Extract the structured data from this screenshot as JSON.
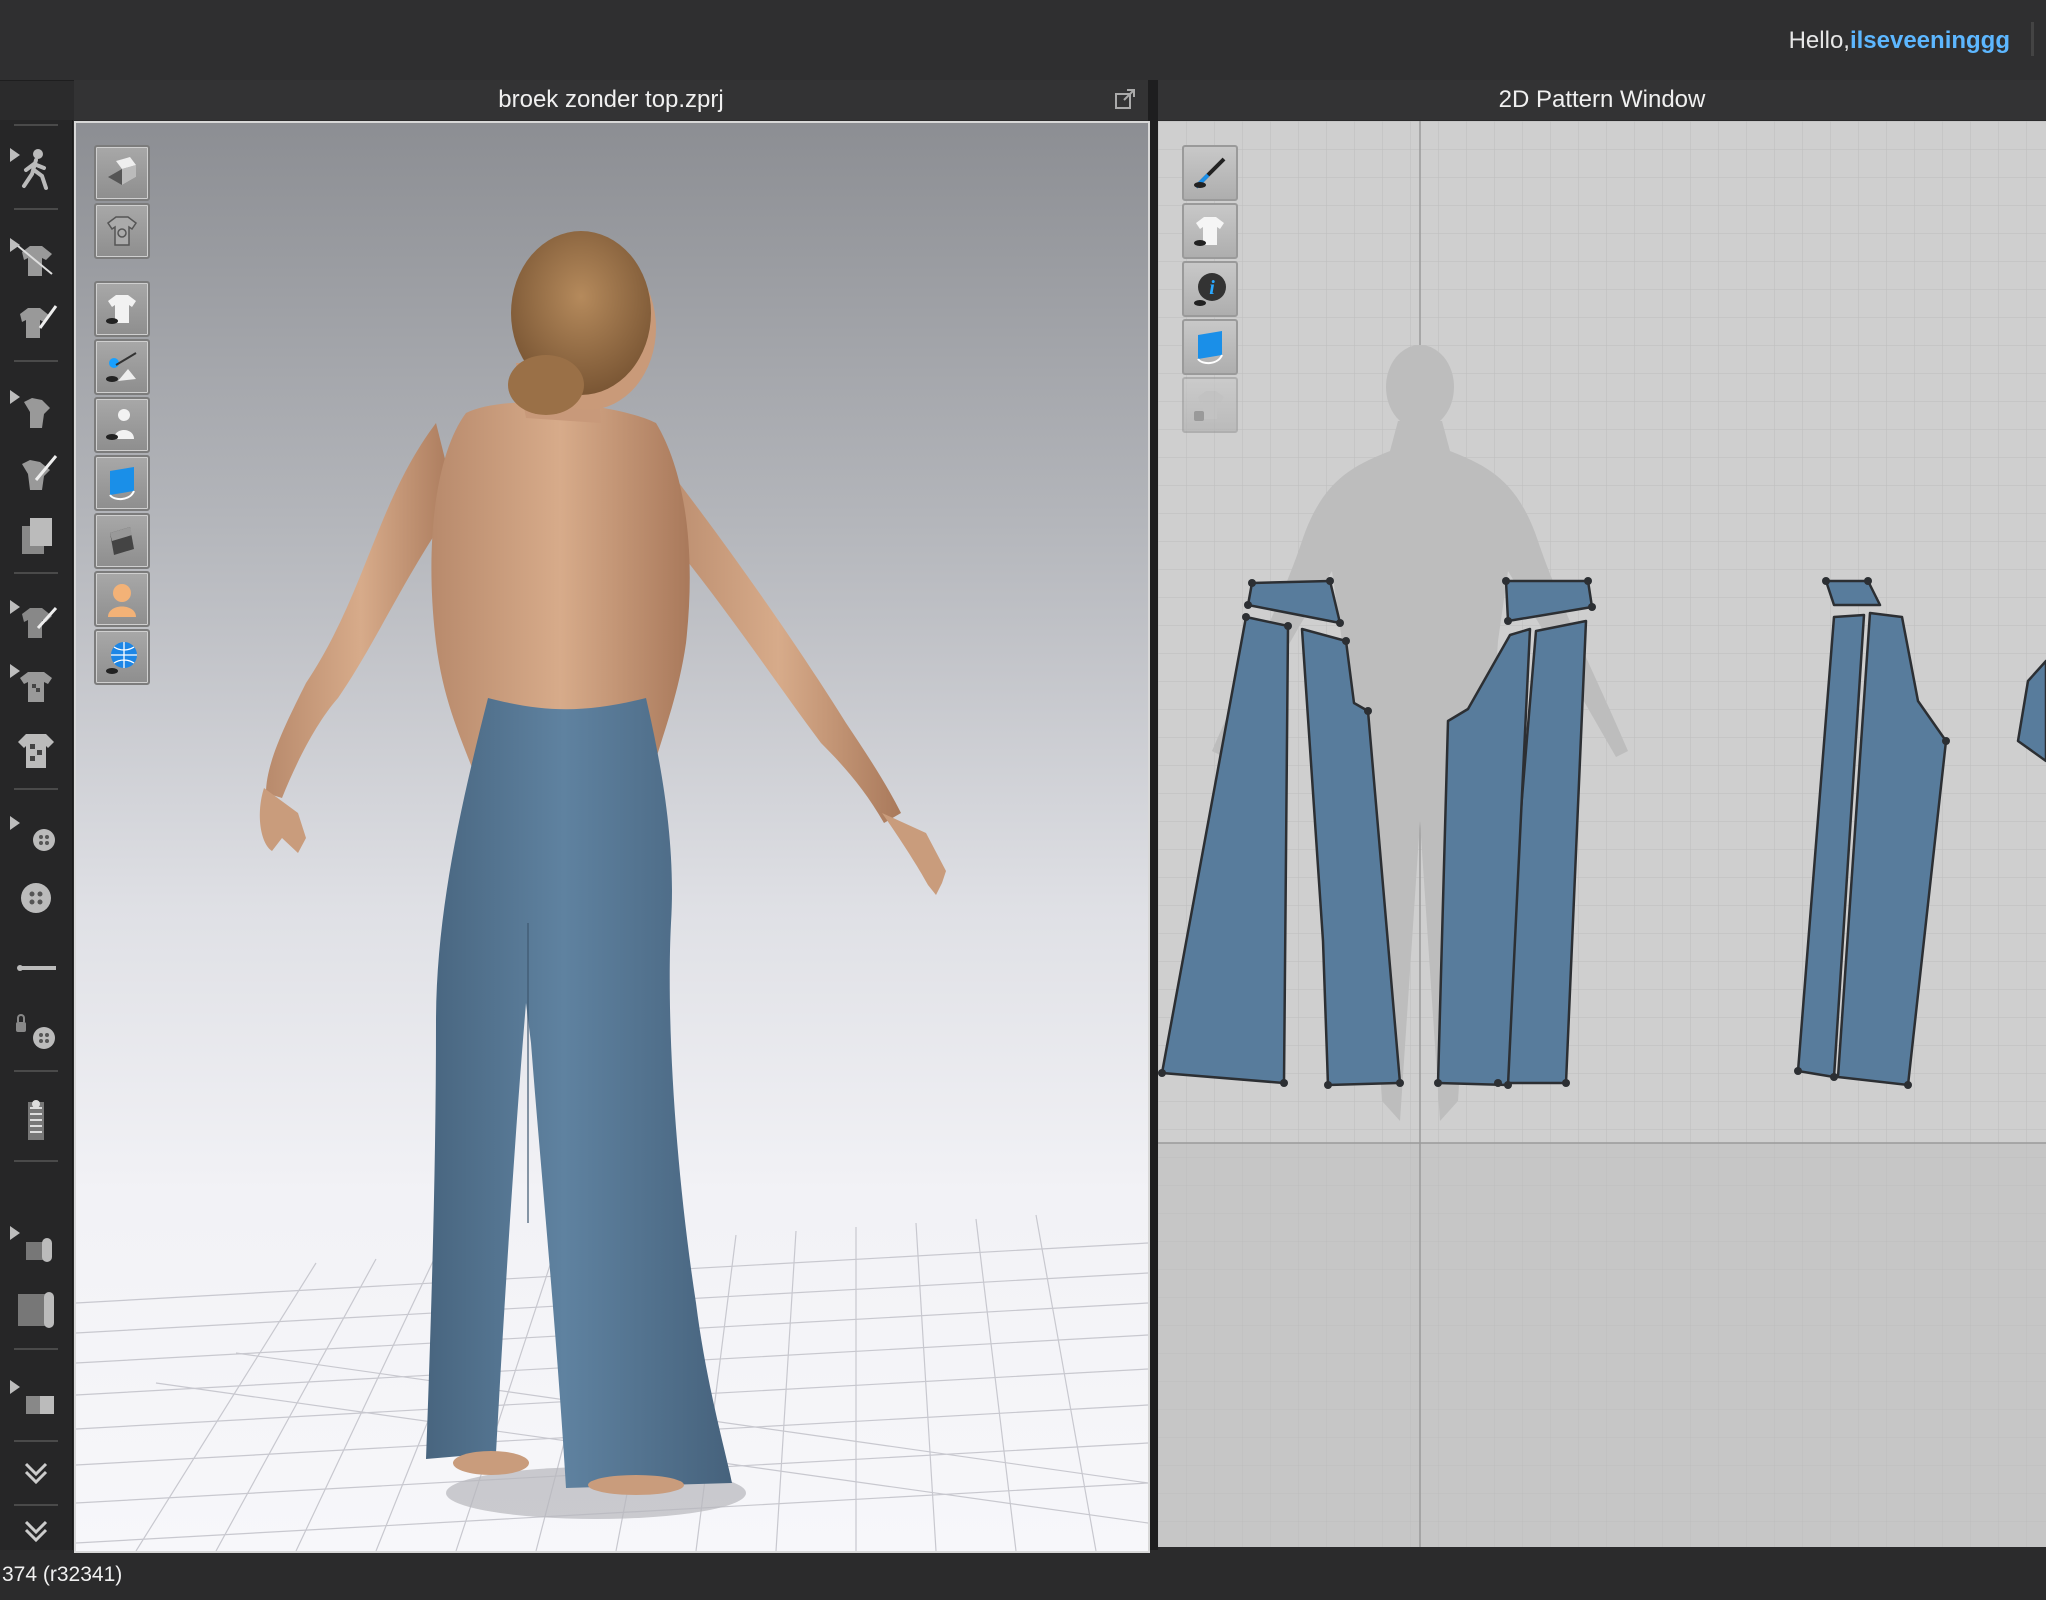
{
  "header": {
    "greeting": "Hello,",
    "username": "ilseveeninggg"
  },
  "panels": {
    "view3d_title": "broek zonder top.zprj",
    "view2d_title": "2D Pattern Window"
  },
  "status_bar": {
    "text": "374 (r32341)"
  },
  "colors": {
    "accent_link": "#5db7ff",
    "fabric": "#587c9c",
    "background_dark": "#2b2b2c"
  },
  "toolbar_icons": [
    "avatar-pose-icon",
    "edit-garment-icon",
    "edit-curvature-icon",
    "transform-pattern-icon",
    "edit-pattern-icon",
    "add-pattern-icon",
    "texture-edit-icon",
    "graphic-icon",
    "print-icon",
    "button-select-icon",
    "button-icon",
    "topstitch-icon",
    "buttonhole-lock-icon",
    "zipper-icon",
    "fabric-roll-icon",
    "fabric-icon",
    "material-icon",
    "expand-icon",
    "expand-more-icon"
  ],
  "view3d_buttons": [
    "display-box-icon",
    "garment-texture-icon",
    "show-garment-icon",
    "show-pins-icon",
    "show-avatar-icon",
    "fabric-display-icon",
    "surface-display-icon",
    "avatar-skin-icon",
    "environment-icon"
  ],
  "view2d_buttons": [
    "show-sewing-lines-icon",
    "show-garment-2d-icon",
    "info-icon",
    "show-fabric-2d-icon",
    "lock-pattern-icon"
  ]
}
